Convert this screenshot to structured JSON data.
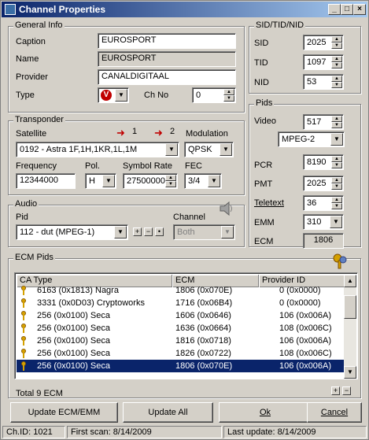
{
  "window": {
    "title": "Channel Properties"
  },
  "general": {
    "legend": "General Info",
    "caption_label": "Caption",
    "caption": "EUROSPORT",
    "name_label": "Name",
    "name": "EUROSPORT",
    "provider_label": "Provider",
    "provider": "CANALDIGITAAL",
    "type_label": "Type",
    "chno_label": "Ch No",
    "chno": "0"
  },
  "sid": {
    "legend": "SID/TID/NID",
    "sid_label": "SID",
    "sid": "2025",
    "tid_label": "TID",
    "tid": "1097",
    "nid_label": "NID",
    "nid": "53"
  },
  "transponder": {
    "legend": "Transponder",
    "satellite_label": "Satellite",
    "sat1": "1",
    "sat2": "2",
    "modulation_label": "Modulation",
    "satellite": "0192 - Astra 1F,1H,1KR,1L,1M",
    "modulation": "QPSK",
    "frequency_label": "Frequency",
    "frequency": "12344000",
    "pol_label": "Pol.",
    "pol": "H",
    "symbol_label": "Symbol Rate",
    "symbol": "27500000",
    "fec_label": "FEC",
    "fec": "3/4"
  },
  "audio": {
    "legend": "Audio",
    "pid_label": "Pid",
    "pid": "112 - dut (MPEG-1)",
    "channel_label": "Channel",
    "channel": "Both"
  },
  "pids": {
    "legend": "Pids",
    "video_label": "Video",
    "video": "517",
    "video_type": "MPEG-2",
    "pcr_label": "PCR",
    "pcr": "8190",
    "pmt_label": "PMT",
    "pmt": "2025",
    "teletext_label": "Teletext",
    "teletext": "36",
    "emm_label": "EMM",
    "emm": "310",
    "ecm_label": "ECM",
    "ecm": "1806"
  },
  "ecm": {
    "legend": "ECM Pids",
    "col_catype": "CA Type",
    "col_ecm": "ECM",
    "col_provider": "Provider ID",
    "rows": [
      {
        "catype": "6163  (0x1813) Nagra",
        "ecm": "1806  (0x070E)",
        "provider": "0  (0x0000)"
      },
      {
        "catype": "3331  (0x0D03) Cryptoworks",
        "ecm": "1716  (0x06B4)",
        "provider": "0  (0x0000)"
      },
      {
        "catype": "256  (0x0100) Seca",
        "ecm": "1606  (0x0646)",
        "provider": "106  (0x006A)"
      },
      {
        "catype": "256  (0x0100) Seca",
        "ecm": "1636  (0x0664)",
        "provider": "108  (0x006C)"
      },
      {
        "catype": "256  (0x0100) Seca",
        "ecm": "1816  (0x0718)",
        "provider": "106  (0x006A)"
      },
      {
        "catype": "256  (0x0100) Seca",
        "ecm": "1826  (0x0722)",
        "provider": "108  (0x006C)"
      },
      {
        "catype": "256  (0x0100) Seca",
        "ecm": "1806  (0x070E)",
        "provider": "106  (0x006A)"
      }
    ],
    "total": "Total 9 ECM"
  },
  "buttons": {
    "update_ecm": "Update ECM/EMM",
    "update_all": "Update All",
    "ok": "Ok",
    "cancel": "Cancel"
  },
  "status": {
    "chid": "Ch.ID: 1021",
    "first_scan": "First scan: 8/14/2009",
    "last_update": "Last update: 8/14/2009"
  },
  "colors": {
    "title_start": "#0a246a",
    "title_end": "#a6caf0",
    "selection": "#0a246a",
    "face": "#d4d0c8"
  }
}
